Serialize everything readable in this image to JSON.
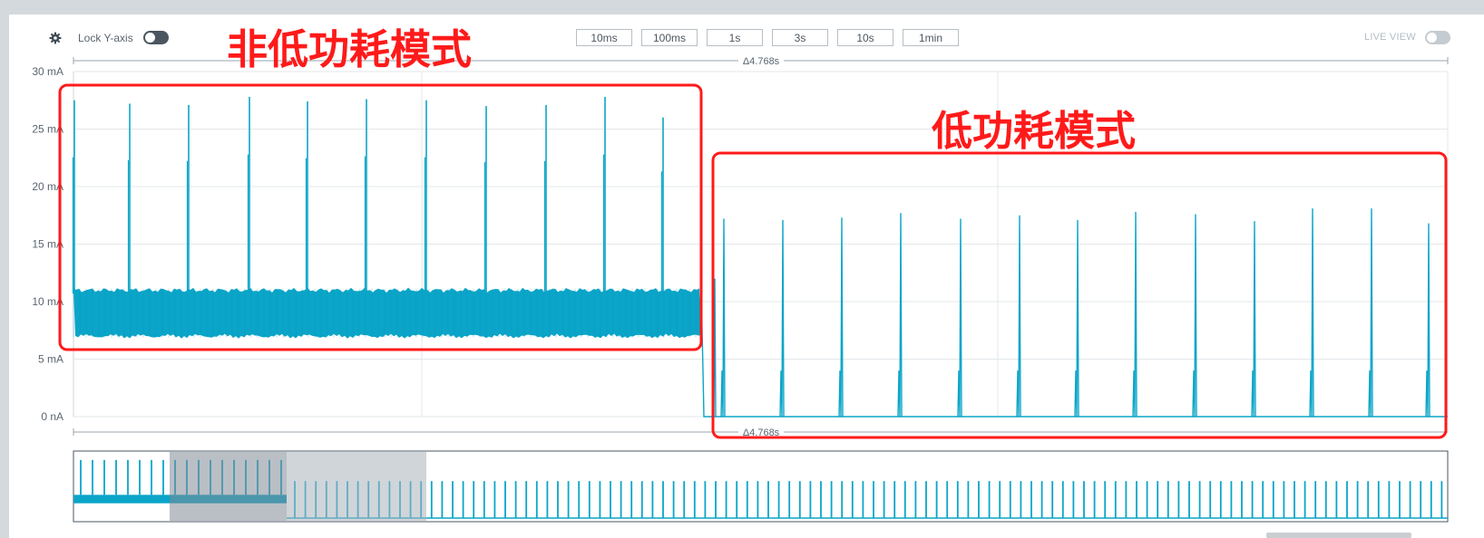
{
  "toolbar": {
    "lock_label": "Lock Y-axis",
    "live_label": "LIVE VIEW",
    "window_buttons": [
      "10ms",
      "100ms",
      "1s",
      "3s",
      "10s",
      "1min"
    ]
  },
  "annotations": {
    "normal_mode": "非低功耗模式",
    "low_power_mode": "低功耗模式",
    "color": "#ff1a1a"
  },
  "chart_data": {
    "type": "line",
    "title": "",
    "xlabel": "",
    "ylabel": "",
    "ylim": [
      0,
      30
    ],
    "y_ticks": [
      "0 nA",
      "5 mA",
      "10 mA",
      "15 mA",
      "20 mA",
      "25 mA",
      "30 mA"
    ],
    "selection_delta": "Δ4.768s",
    "grid": true,
    "series_color": "#0aa5c8",
    "series": [
      {
        "segment": "non-low-power",
        "baseline_band_mA": [
          7,
          11
        ],
        "spike_peaks_mA": [
          27.5,
          27.2,
          27.1,
          27.8,
          27.4,
          27.6,
          27.5,
          27.0,
          27.1,
          27.8,
          26.0
        ]
      },
      {
        "segment": "low-power",
        "baseline_mA": 0,
        "spike_peaks_mA": [
          17.2,
          17.1,
          17.3,
          17.7,
          17.2,
          17.5,
          17.1,
          17.8,
          17.6,
          17.0,
          18.1,
          18.1,
          16.8
        ]
      }
    ]
  }
}
